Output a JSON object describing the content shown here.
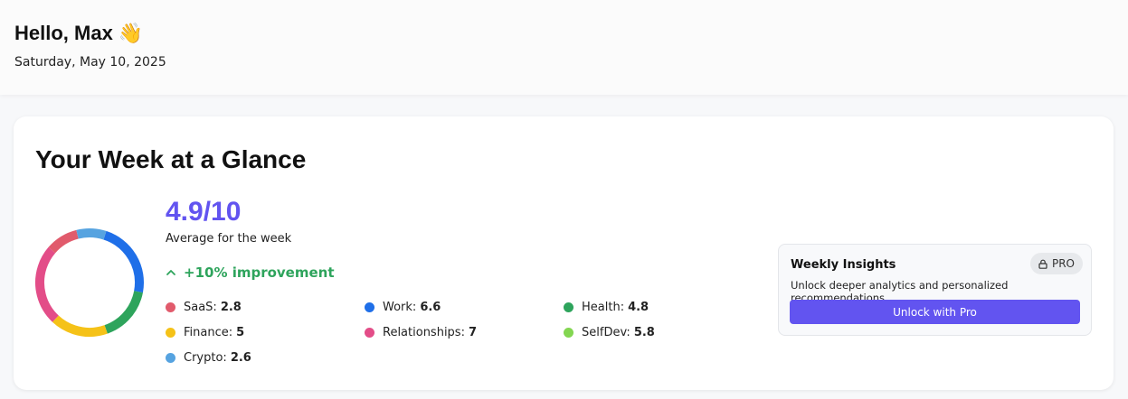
{
  "header": {
    "greeting": "Hello, Max 👋",
    "date": "Saturday, May 10, 2025"
  },
  "card": {
    "title": "Your Week at a Glance",
    "score": "4.9/10",
    "score_sub": "Average for the week",
    "improvement_icon": "chevron-up-icon",
    "improvement": "+10% improvement",
    "categories": [
      {
        "label": "SaaS:",
        "value": "2.8",
        "color": "#e15b6c"
      },
      {
        "label": "Work:",
        "value": "6.6",
        "color": "#1f6fe8"
      },
      {
        "label": "Health:",
        "value": "4.8",
        "color": "#2ea45c"
      },
      {
        "label": "Finance:",
        "value": "5",
        "color": "#f5c218"
      },
      {
        "label": "Relationships:",
        "value": "7",
        "color": "#e34d88"
      },
      {
        "label": "SelfDev:",
        "value": "5.8",
        "color": "#83d651"
      },
      {
        "label": "Crypto:",
        "value": "2.6",
        "color": "#56a3e0"
      }
    ]
  },
  "insights": {
    "title": "Weekly Insights",
    "badge": "PRO",
    "badge_icon": "lock-icon",
    "description": "Unlock deeper analytics and personalized recommendations.",
    "button_label": "Unlock with Pro"
  },
  "colors": {
    "accent": "#6254f0",
    "success": "#2ea45c"
  }
}
